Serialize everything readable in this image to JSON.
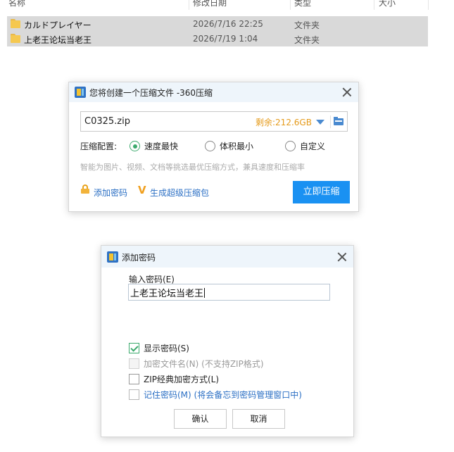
{
  "file_list": {
    "columns": {
      "name": "名称",
      "modified": "修改日期",
      "type": "类型",
      "size": "大小"
    },
    "rows": [
      {
        "name": "カルドプレイヤー",
        "modified": "2026/7/16 22:25",
        "type": "文件夹"
      },
      {
        "name": "上老王论坛当老王",
        "modified": "2026/7/19 1:04",
        "type": "文件夹"
      }
    ]
  },
  "compress_dialog": {
    "title": "您将创建一个压缩文件 -360压缩",
    "filename": "C0325.zip",
    "free_space": "剩余:212.6GB",
    "config_label": "压缩配置:",
    "options": [
      "速度最快",
      "体积最小",
      "自定义"
    ],
    "selected_option": "速度最快",
    "hint": "智能为图片、视频、文档等挑选最优压缩方式，兼具速度和压缩率",
    "add_password_link": "添加密码",
    "super_package_link": "生成超级压缩包",
    "compress_button": "立即压缩",
    "accent_color": "#1a91f2",
    "selected_color": "#3caa6d"
  },
  "password_dialog": {
    "title": "添加密码",
    "input_label": "输入密码(E)",
    "password_value": "上老王论坛当老王",
    "checkboxes": {
      "show_password": {
        "label": "显示密码(S)",
        "checked": true
      },
      "encrypt_filenames": {
        "label": "加密文件名(N) (不支持ZIP格式)",
        "checked": false,
        "disabled": true
      },
      "zip_classic": {
        "label": "ZIP经典加密方式(L)",
        "checked": false
      },
      "remember_password": {
        "label": "记住密码(M) (将会备忘到密码管理窗口中)",
        "checked": false
      }
    },
    "ok_button": "确认",
    "cancel_button": "取消"
  }
}
